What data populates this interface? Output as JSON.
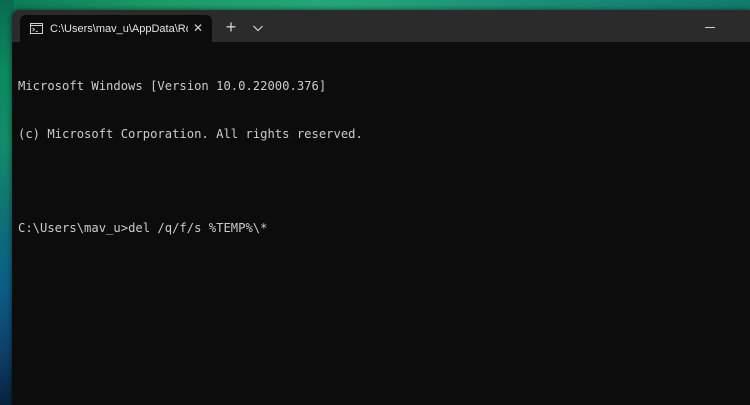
{
  "window": {
    "tab": {
      "icon": "cmd-icon",
      "title": "C:\\Users\\mav_u\\AppData\\Roam",
      "close_label": "✕"
    },
    "new_tab_label": "+",
    "dropdown_icon": "chevron-down-icon",
    "minimize_icon": "minimize-icon"
  },
  "terminal": {
    "lines": [
      "Microsoft Windows [Version 10.0.22000.376]",
      "(c) Microsoft Corporation. All rights reserved."
    ],
    "prompt": "C:\\Users\\mav_u>",
    "command": "del /q/f/s %TEMP%\\*"
  }
}
